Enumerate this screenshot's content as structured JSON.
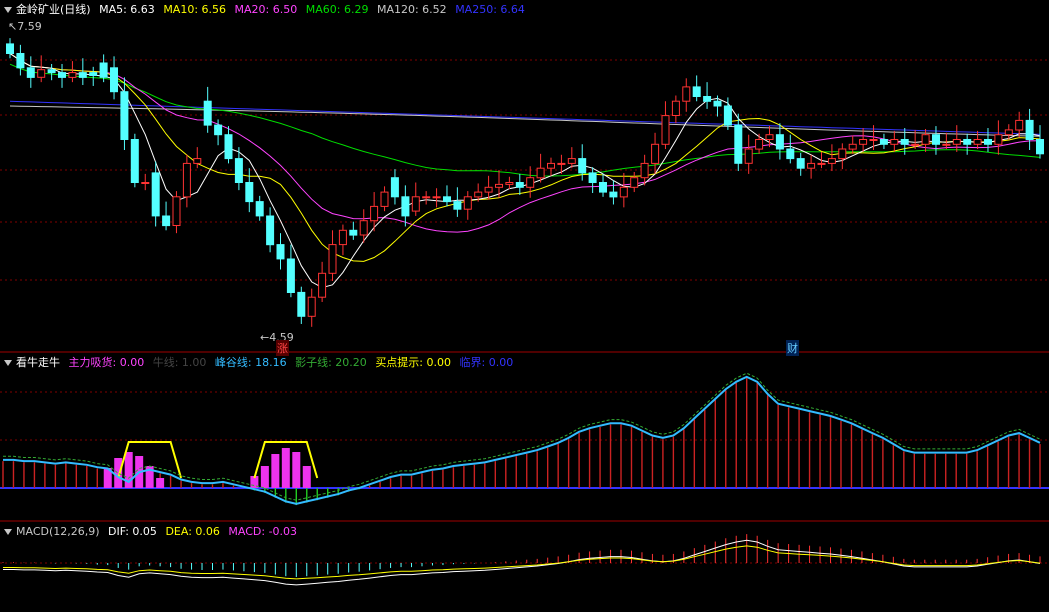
{
  "panels": {
    "main": {
      "title": "金岭矿业(日线)",
      "legend": [
        {
          "label": "MA5: 6.63",
          "color": "#ffffff"
        },
        {
          "label": "MA10: 6.56",
          "color": "#ffff00"
        },
        {
          "label": "MA20: 6.50",
          "color": "#ff44ff"
        },
        {
          "label": "MA60: 6.29",
          "color": "#00dd00"
        },
        {
          "label": "MA120: 6.52",
          "color": "#c8c8c8"
        },
        {
          "label": "MA250: 6.64",
          "color": "#3333ff"
        }
      ],
      "high_label": "7.59",
      "low_label": "4.59",
      "marker_zhang": "涨",
      "marker_cai": "财"
    },
    "indicator": {
      "title": "看牛走牛",
      "legend": [
        {
          "label": "主力吸货: 0.00",
          "color": "#ff44ff"
        },
        {
          "label": "牛线: 1.00",
          "color": "#444444"
        },
        {
          "label": "峰谷线: 18.16",
          "color": "#33bbff"
        },
        {
          "label": "影子线: 20.20",
          "color": "#33aa33"
        },
        {
          "label": "买点提示: 0.00",
          "color": "#ffff00"
        },
        {
          "label": "临界: 0.00",
          "color": "#3333ff"
        }
      ]
    },
    "macd": {
      "title": "MACD(12,26,9)",
      "legend": [
        {
          "label": "DIF: 0.05",
          "color": "#ffffff"
        },
        {
          "label": "DEA: 0.06",
          "color": "#ffff00"
        },
        {
          "label": "MACD: -0.03",
          "color": "#ff44ff"
        }
      ]
    }
  },
  "colors": {
    "up": "#ff3333",
    "down": "#54ffff",
    "grid": "#800000",
    "border": "#a00000",
    "ma5": "#ffffff",
    "ma10": "#ffff00",
    "ma20": "#ff44ff",
    "ma60": "#00dd00",
    "ma120": "#c8c8c8",
    "ma250": "#3333ff"
  },
  "chart_data": [
    {
      "type": "candlestick",
      "title": "金岭矿业(日线)",
      "ylim": [
        4.4,
        7.8
      ],
      "high": 7.59,
      "low": 4.59,
      "close": [
        7.45,
        7.3,
        7.2,
        7.28,
        7.25,
        7.2,
        7.25,
        7.2,
        7.22,
        7.2,
        7.05,
        6.55,
        6.1,
        6.1,
        5.75,
        5.65,
        5.95,
        6.3,
        6.35,
        6.7,
        6.6,
        6.35,
        6.1,
        5.9,
        5.75,
        5.45,
        5.3,
        4.95,
        4.7,
        4.9,
        5.15,
        5.45,
        5.6,
        5.55,
        5.7,
        5.85,
        6.0,
        5.95,
        5.75,
        5.95,
        5.95,
        5.95,
        5.9,
        5.82,
        5.95,
        6.0,
        6.05,
        6.08,
        6.1,
        6.05,
        6.15,
        6.25,
        6.3,
        6.3,
        6.35,
        6.2,
        6.1,
        6.0,
        5.95,
        6.05,
        6.15,
        6.3,
        6.5,
        6.8,
        6.95,
        7.1,
        7.0,
        6.95,
        6.9,
        6.7,
        6.3,
        6.45,
        6.55,
        6.6,
        6.45,
        6.35,
        6.25,
        6.3,
        6.3,
        6.35,
        6.45,
        6.5,
        6.55,
        6.55,
        6.5,
        6.55,
        6.5,
        6.5,
        6.6,
        6.5,
        6.5,
        6.55,
        6.5,
        6.55,
        6.5,
        6.6,
        6.65,
        6.75,
        6.55,
        6.4
      ],
      "open": [
        7.55,
        7.45,
        7.3,
        7.2,
        7.28,
        7.25,
        7.2,
        7.25,
        7.25,
        7.35,
        7.3,
        7.05,
        6.55,
        6.1,
        6.2,
        5.75,
        5.65,
        5.95,
        6.3,
        6.95,
        6.7,
        6.6,
        6.35,
        6.1,
        5.9,
        5.75,
        5.45,
        5.3,
        4.95,
        4.7,
        4.9,
        5.15,
        5.45,
        5.6,
        5.55,
        5.7,
        5.85,
        6.15,
        5.95,
        5.8,
        5.95,
        5.95,
        5.95,
        5.9,
        5.82,
        5.95,
        6.0,
        6.05,
        6.08,
        6.1,
        6.05,
        6.15,
        6.25,
        6.3,
        6.3,
        6.35,
        6.2,
        6.1,
        6.0,
        5.95,
        6.05,
        6.15,
        6.3,
        6.5,
        6.8,
        6.95,
        7.1,
        7.0,
        6.95,
        6.9,
        6.7,
        6.3,
        6.45,
        6.55,
        6.6,
        6.45,
        6.35,
        6.25,
        6.3,
        6.3,
        6.35,
        6.45,
        6.5,
        6.55,
        6.55,
        6.5,
        6.55,
        6.5,
        6.5,
        6.6,
        6.5,
        6.5,
        6.55,
        6.5,
        6.55,
        6.5,
        6.6,
        6.65,
        6.75,
        6.55
      ]
    },
    {
      "type": "line",
      "title": "看牛走牛",
      "series": [
        {
          "name": "峰谷线",
          "last": 18.16
        },
        {
          "name": "影子线",
          "last": 20.2
        },
        {
          "name": "主力吸货",
          "last": 0.0
        },
        {
          "name": "牛线",
          "last": 1.0
        },
        {
          "name": "买点提示",
          "last": 0.0
        },
        {
          "name": "临界",
          "last": 0.0
        }
      ],
      "values": [
        22,
        22,
        21,
        21,
        20,
        19,
        20,
        19,
        18,
        16,
        15,
        8,
        4,
        12,
        14,
        12,
        10,
        6,
        4,
        3,
        3,
        4,
        2,
        0,
        -2,
        -4,
        -8,
        -12,
        -14,
        -12,
        -10,
        -8,
        -6,
        -3,
        -1,
        2,
        5,
        8,
        10,
        10,
        12,
        14,
        15,
        17,
        18,
        19,
        20,
        22,
        24,
        26,
        28,
        30,
        33,
        36,
        40,
        45,
        48,
        50,
        52,
        52,
        50,
        46,
        42,
        40,
        42,
        48,
        56,
        64,
        72,
        80,
        86,
        90,
        86,
        76,
        68,
        66,
        64,
        62,
        60,
        58,
        55,
        52,
        48,
        44,
        40,
        35,
        30,
        28,
        28,
        28,
        28,
        28,
        28,
        30,
        34,
        38,
        42,
        44,
        40,
        36
      ]
    },
    {
      "type": "bar",
      "title": "MACD(12,26,9)",
      "series": [
        {
          "name": "DIF",
          "last": 0.05
        },
        {
          "name": "DEA",
          "last": 0.06
        },
        {
          "name": "MACD",
          "last": -0.03
        }
      ],
      "ylim": [
        -0.6,
        0.25
      ]
    }
  ]
}
